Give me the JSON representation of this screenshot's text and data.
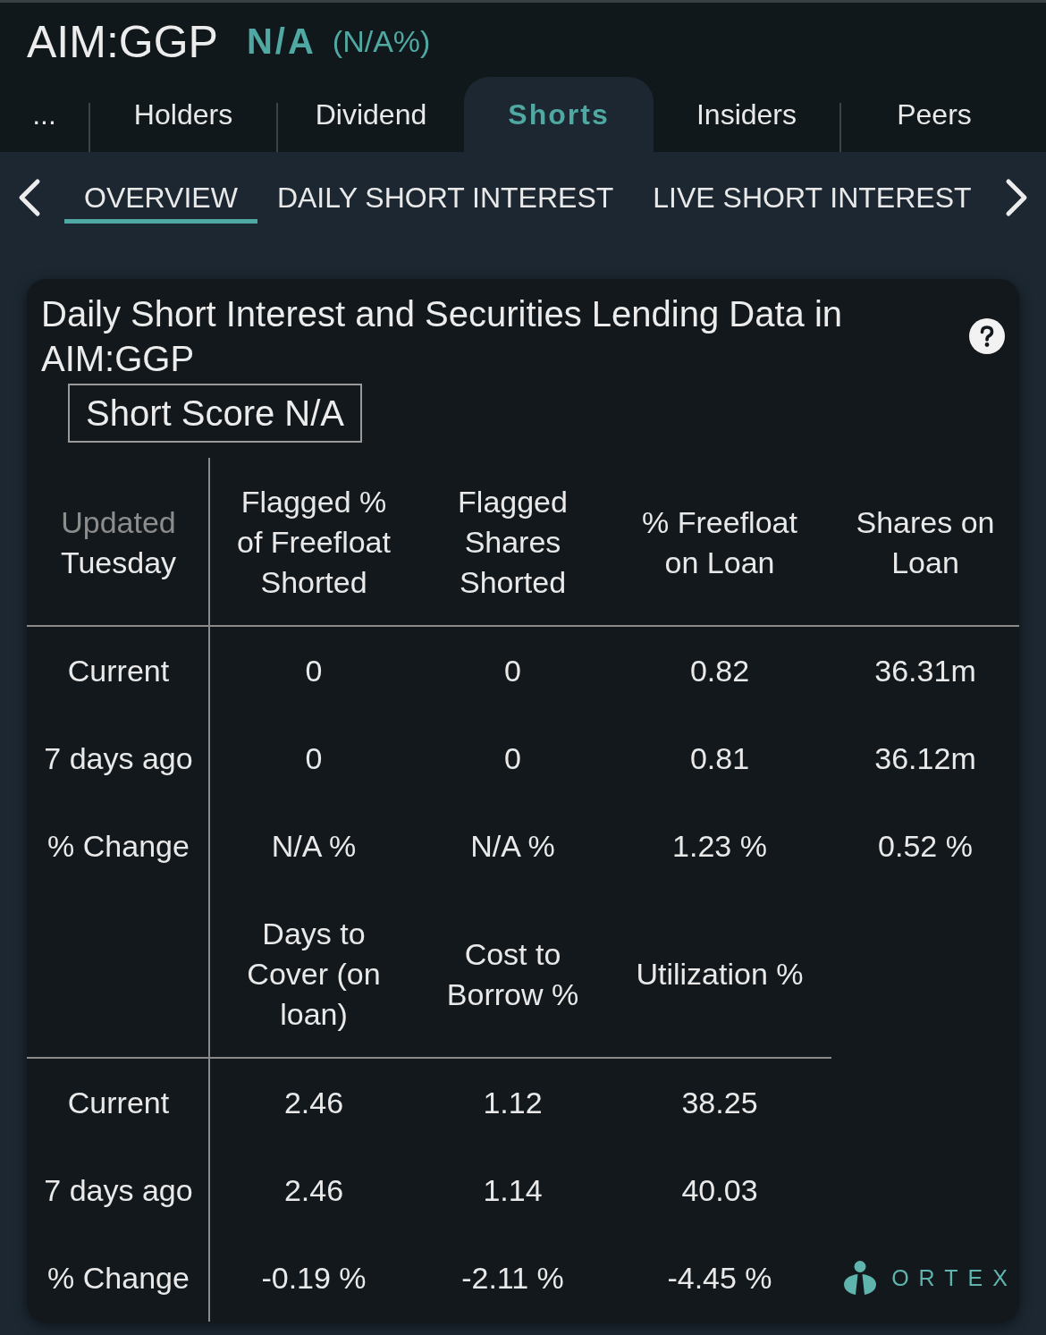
{
  "header": {
    "symbol": "AIM:GGP",
    "price": "N/A",
    "change": "(N/A%)"
  },
  "tabs": [
    {
      "label": "...",
      "selected": false
    },
    {
      "label": "Holders",
      "selected": false
    },
    {
      "label": "Dividend",
      "selected": false
    },
    {
      "label": "Shorts",
      "selected": true
    },
    {
      "label": "Insiders",
      "selected": false
    },
    {
      "label": "Peers",
      "selected": false
    }
  ],
  "subtabs": [
    {
      "label": "OVERVIEW",
      "selected": true
    },
    {
      "label": "DAILY SHORT INTEREST",
      "selected": false
    },
    {
      "label": "LIVE SHORT INTEREST",
      "selected": false
    }
  ],
  "card": {
    "title": "Daily Short Interest and Securities Lending Data in AIM:GGP",
    "short_score": "Short Score N/A",
    "tables": [
      {
        "corner": {
          "label": "Updated",
          "value": "Tuesday"
        },
        "columns": [
          "Flagged % of Freefloat Shorted",
          "Flagged Shares Shorted",
          "% Freefloat on Loan",
          "Shares on Loan"
        ],
        "rows": [
          {
            "label": "Current",
            "values": [
              "0",
              "0",
              "0.82",
              "36.31m"
            ]
          },
          {
            "label": "7 days ago",
            "values": [
              "0",
              "0",
              "0.81",
              "36.12m"
            ]
          },
          {
            "label": "% Change",
            "values": [
              "N/A %",
              "N/A %",
              "1.23 %",
              "0.52 %"
            ]
          }
        ]
      },
      {
        "columns": [
          "Days to Cover (on loan)",
          "Cost to Borrow %",
          "Utilization %"
        ],
        "rows": [
          {
            "label": "Current",
            "values": [
              "2.46",
              "1.12",
              "38.25"
            ]
          },
          {
            "label": "7 days ago",
            "values": [
              "2.46",
              "1.14",
              "40.03"
            ]
          },
          {
            "label": "% Change",
            "values": [
              "-0.19 %",
              "-2.11 %",
              "-4.45 %"
            ]
          }
        ]
      }
    ],
    "brand": "ORTEX"
  }
}
